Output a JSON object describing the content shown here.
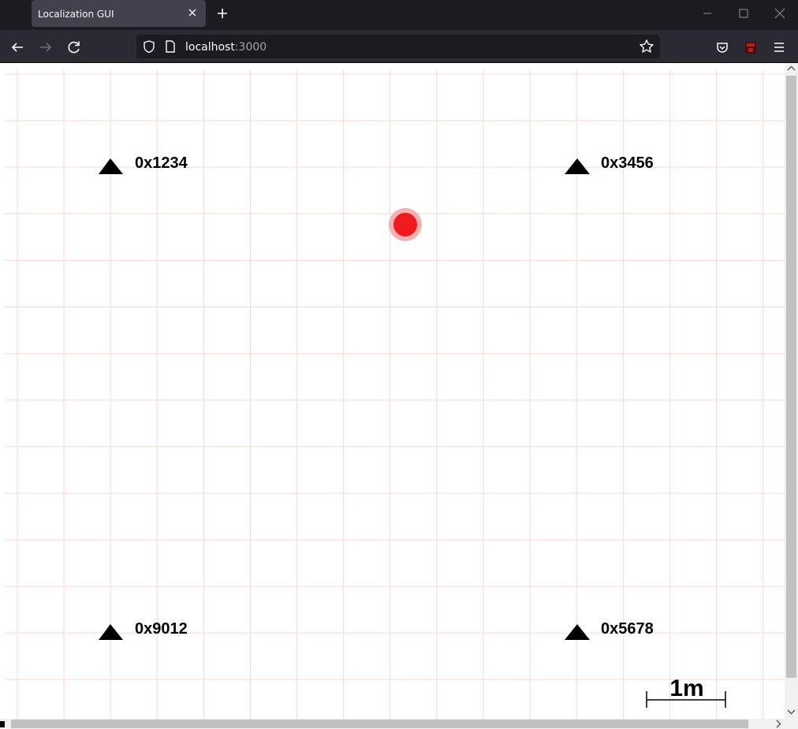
{
  "browser": {
    "tab_title": "Localization GUI",
    "url_host": "localhost",
    "url_port": ":3000",
    "icons": {
      "back": "arrow-left-icon",
      "forward": "arrow-right-icon",
      "reload": "reload-icon",
      "shield": "shield-icon",
      "page": "page-icon",
      "bookmark": "star-icon",
      "pocket": "pocket-icon",
      "extension": "extension-icon",
      "menu": "hamburger-menu-icon"
    }
  },
  "map": {
    "anchors": [
      {
        "id": "0x1234"
      },
      {
        "id": "0x3456"
      },
      {
        "id": "0x9012"
      },
      {
        "id": "0x5678"
      }
    ],
    "scale_label": "1m",
    "colors": {
      "grid": "#fbd7d7",
      "tag": "#ee1c1c",
      "tag_halo": "#f6b2b2",
      "anchor": "#000000"
    }
  }
}
